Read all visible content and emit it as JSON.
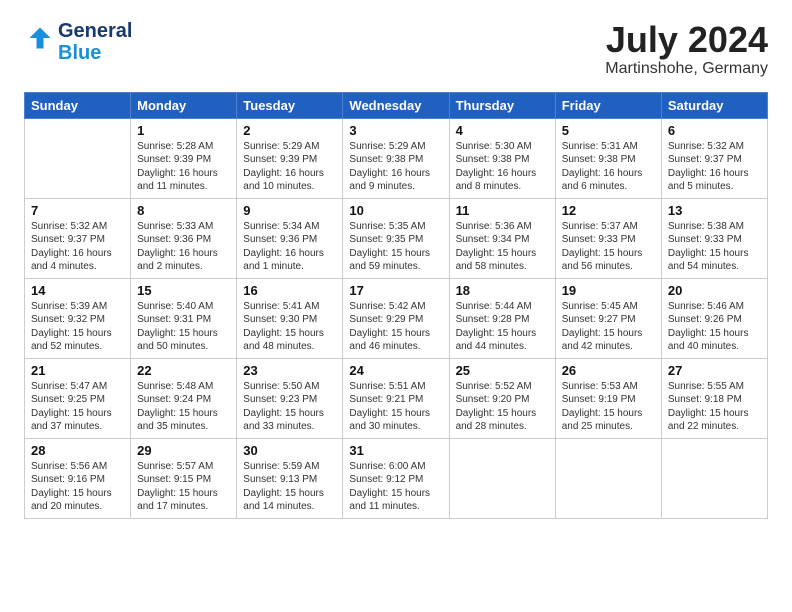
{
  "logo": {
    "line1": "General",
    "line2": "Blue"
  },
  "title": "July 2024",
  "subtitle": "Martinshohe, Germany",
  "weekdays": [
    "Sunday",
    "Monday",
    "Tuesday",
    "Wednesday",
    "Thursday",
    "Friday",
    "Saturday"
  ],
  "weeks": [
    [
      {
        "day": "",
        "info": ""
      },
      {
        "day": "1",
        "info": "Sunrise: 5:28 AM\nSunset: 9:39 PM\nDaylight: 16 hours\nand 11 minutes."
      },
      {
        "day": "2",
        "info": "Sunrise: 5:29 AM\nSunset: 9:39 PM\nDaylight: 16 hours\nand 10 minutes."
      },
      {
        "day": "3",
        "info": "Sunrise: 5:29 AM\nSunset: 9:38 PM\nDaylight: 16 hours\nand 9 minutes."
      },
      {
        "day": "4",
        "info": "Sunrise: 5:30 AM\nSunset: 9:38 PM\nDaylight: 16 hours\nand 8 minutes."
      },
      {
        "day": "5",
        "info": "Sunrise: 5:31 AM\nSunset: 9:38 PM\nDaylight: 16 hours\nand 6 minutes."
      },
      {
        "day": "6",
        "info": "Sunrise: 5:32 AM\nSunset: 9:37 PM\nDaylight: 16 hours\nand 5 minutes."
      }
    ],
    [
      {
        "day": "7",
        "info": "Sunrise: 5:32 AM\nSunset: 9:37 PM\nDaylight: 16 hours\nand 4 minutes."
      },
      {
        "day": "8",
        "info": "Sunrise: 5:33 AM\nSunset: 9:36 PM\nDaylight: 16 hours\nand 2 minutes."
      },
      {
        "day": "9",
        "info": "Sunrise: 5:34 AM\nSunset: 9:36 PM\nDaylight: 16 hours\nand 1 minute."
      },
      {
        "day": "10",
        "info": "Sunrise: 5:35 AM\nSunset: 9:35 PM\nDaylight: 15 hours\nand 59 minutes."
      },
      {
        "day": "11",
        "info": "Sunrise: 5:36 AM\nSunset: 9:34 PM\nDaylight: 15 hours\nand 58 minutes."
      },
      {
        "day": "12",
        "info": "Sunrise: 5:37 AM\nSunset: 9:33 PM\nDaylight: 15 hours\nand 56 minutes."
      },
      {
        "day": "13",
        "info": "Sunrise: 5:38 AM\nSunset: 9:33 PM\nDaylight: 15 hours\nand 54 minutes."
      }
    ],
    [
      {
        "day": "14",
        "info": "Sunrise: 5:39 AM\nSunset: 9:32 PM\nDaylight: 15 hours\nand 52 minutes."
      },
      {
        "day": "15",
        "info": "Sunrise: 5:40 AM\nSunset: 9:31 PM\nDaylight: 15 hours\nand 50 minutes."
      },
      {
        "day": "16",
        "info": "Sunrise: 5:41 AM\nSunset: 9:30 PM\nDaylight: 15 hours\nand 48 minutes."
      },
      {
        "day": "17",
        "info": "Sunrise: 5:42 AM\nSunset: 9:29 PM\nDaylight: 15 hours\nand 46 minutes."
      },
      {
        "day": "18",
        "info": "Sunrise: 5:44 AM\nSunset: 9:28 PM\nDaylight: 15 hours\nand 44 minutes."
      },
      {
        "day": "19",
        "info": "Sunrise: 5:45 AM\nSunset: 9:27 PM\nDaylight: 15 hours\nand 42 minutes."
      },
      {
        "day": "20",
        "info": "Sunrise: 5:46 AM\nSunset: 9:26 PM\nDaylight: 15 hours\nand 40 minutes."
      }
    ],
    [
      {
        "day": "21",
        "info": "Sunrise: 5:47 AM\nSunset: 9:25 PM\nDaylight: 15 hours\nand 37 minutes."
      },
      {
        "day": "22",
        "info": "Sunrise: 5:48 AM\nSunset: 9:24 PM\nDaylight: 15 hours\nand 35 minutes."
      },
      {
        "day": "23",
        "info": "Sunrise: 5:50 AM\nSunset: 9:23 PM\nDaylight: 15 hours\nand 33 minutes."
      },
      {
        "day": "24",
        "info": "Sunrise: 5:51 AM\nSunset: 9:21 PM\nDaylight: 15 hours\nand 30 minutes."
      },
      {
        "day": "25",
        "info": "Sunrise: 5:52 AM\nSunset: 9:20 PM\nDaylight: 15 hours\nand 28 minutes."
      },
      {
        "day": "26",
        "info": "Sunrise: 5:53 AM\nSunset: 9:19 PM\nDaylight: 15 hours\nand 25 minutes."
      },
      {
        "day": "27",
        "info": "Sunrise: 5:55 AM\nSunset: 9:18 PM\nDaylight: 15 hours\nand 22 minutes."
      }
    ],
    [
      {
        "day": "28",
        "info": "Sunrise: 5:56 AM\nSunset: 9:16 PM\nDaylight: 15 hours\nand 20 minutes."
      },
      {
        "day": "29",
        "info": "Sunrise: 5:57 AM\nSunset: 9:15 PM\nDaylight: 15 hours\nand 17 minutes."
      },
      {
        "day": "30",
        "info": "Sunrise: 5:59 AM\nSunset: 9:13 PM\nDaylight: 15 hours\nand 14 minutes."
      },
      {
        "day": "31",
        "info": "Sunrise: 6:00 AM\nSunset: 9:12 PM\nDaylight: 15 hours\nand 11 minutes."
      },
      {
        "day": "",
        "info": ""
      },
      {
        "day": "",
        "info": ""
      },
      {
        "day": "",
        "info": ""
      }
    ]
  ]
}
